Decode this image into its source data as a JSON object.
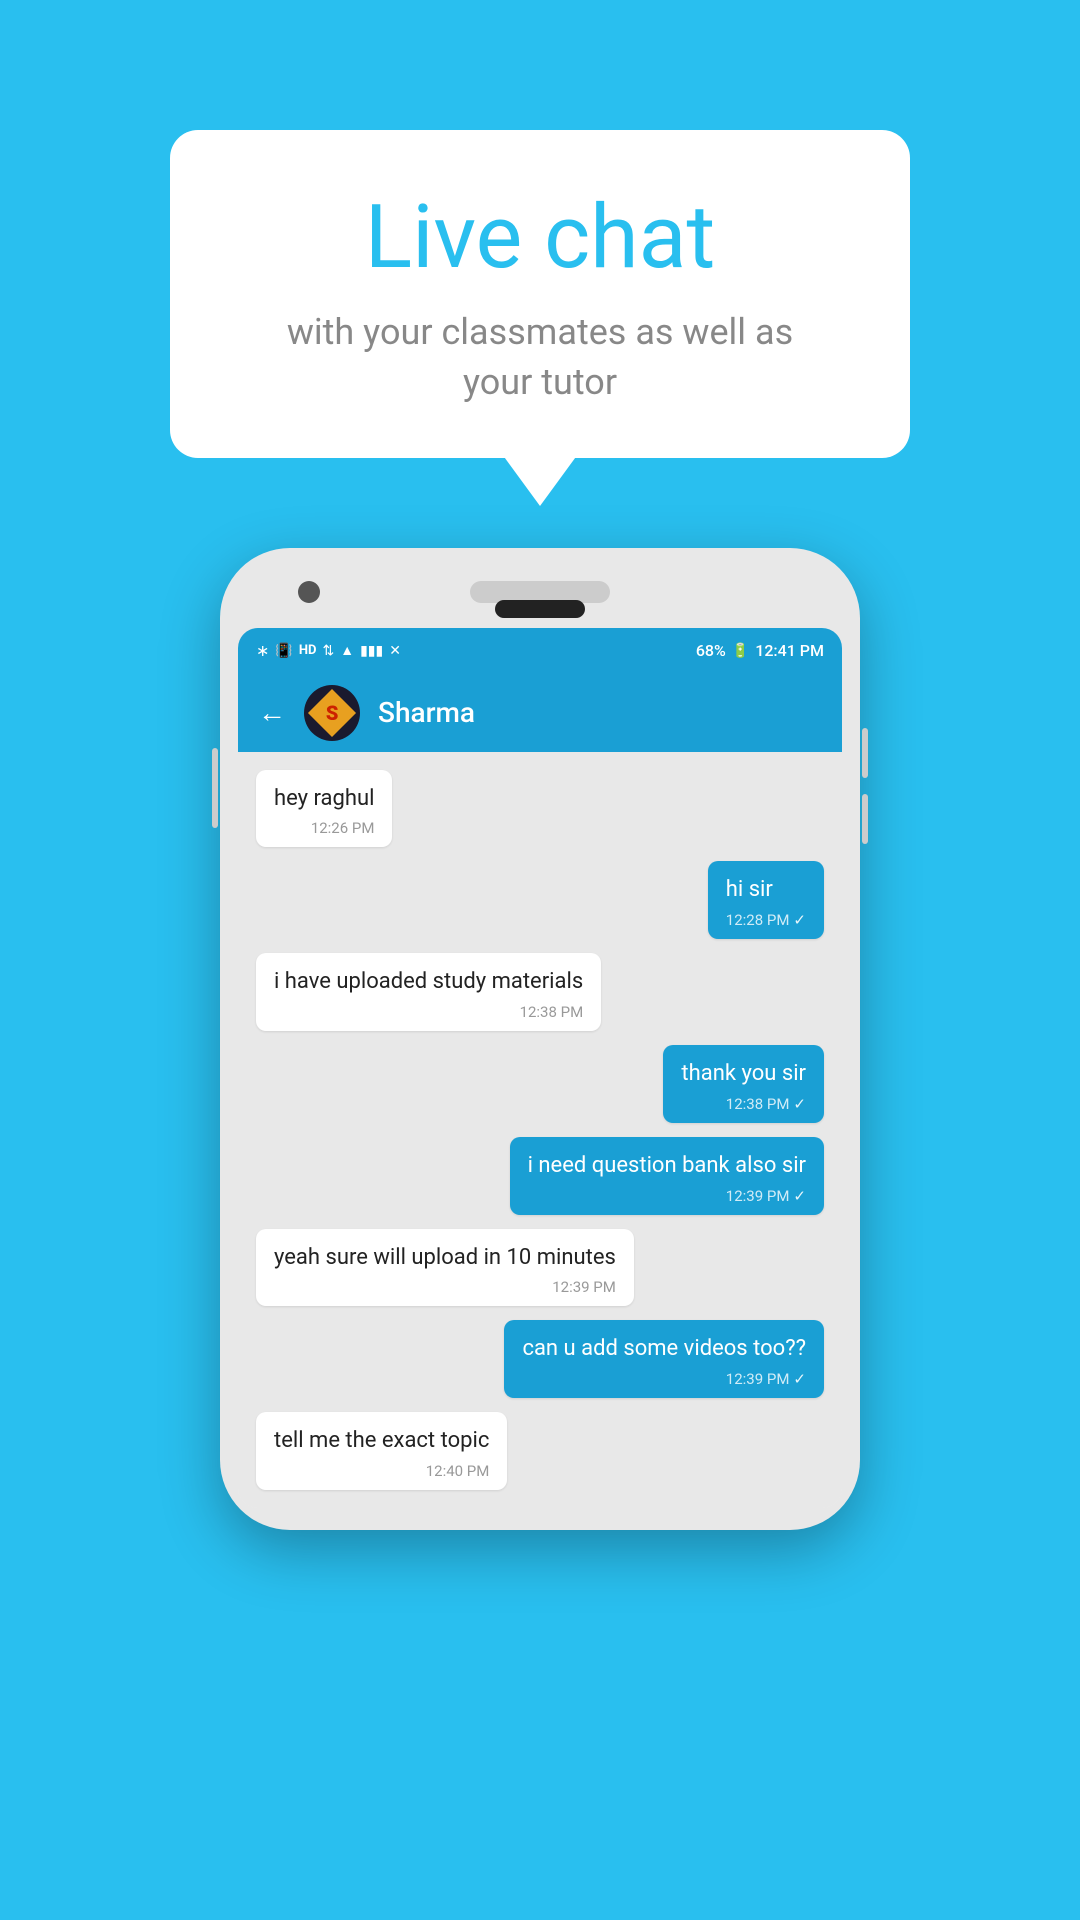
{
  "background_color": "#29BFEF",
  "bubble": {
    "title": "Live chat",
    "subtitle": "with your classmates as well as your tutor"
  },
  "phone": {
    "status_bar": {
      "time": "12:41 PM",
      "battery": "68%",
      "icons": "bluetooth signal hd wifi data"
    },
    "app_bar": {
      "contact_name": "Sharma",
      "back_label": "←"
    },
    "messages": [
      {
        "id": 1,
        "type": "received",
        "text": "hey raghul",
        "time": "12:26 PM"
      },
      {
        "id": 2,
        "type": "sent",
        "text": "hi sir",
        "time": "12:28 PM"
      },
      {
        "id": 3,
        "type": "received",
        "text": "i have uploaded study materials",
        "time": "12:38 PM"
      },
      {
        "id": 4,
        "type": "sent",
        "text": "thank you sir",
        "time": "12:38 PM"
      },
      {
        "id": 5,
        "type": "sent",
        "text": "i need question bank also sir",
        "time": "12:39 PM"
      },
      {
        "id": 6,
        "type": "received",
        "text": "yeah sure will upload in 10 minutes",
        "time": "12:39 PM"
      },
      {
        "id": 7,
        "type": "sent",
        "text": "can u add some videos too??",
        "time": "12:39 PM"
      },
      {
        "id": 8,
        "type": "received",
        "text": "tell me the exact topic",
        "time": "12:40 PM",
        "partial": true
      }
    ]
  }
}
